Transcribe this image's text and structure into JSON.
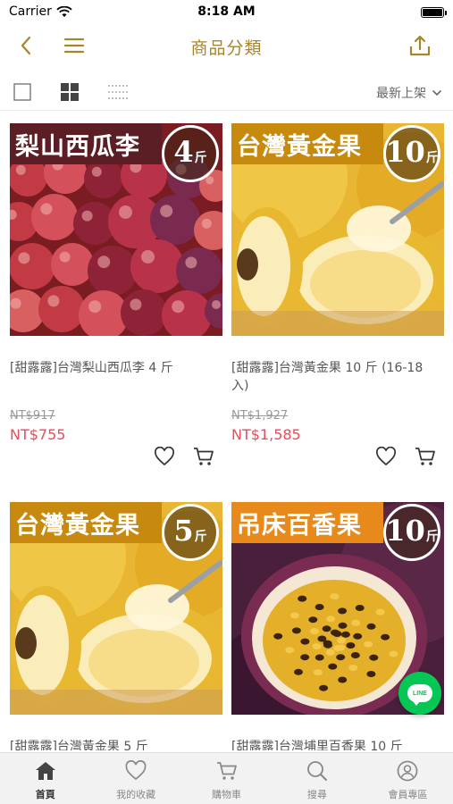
{
  "status_bar": {
    "carrier": "Carrier",
    "time": "8:18 AM",
    "battery_level": 1.0
  },
  "nav": {
    "title": "商品分類",
    "back_icon": "chevron-left-icon",
    "menu_icon": "menu-icon",
    "share_icon": "share-icon",
    "accent_color": "#a7852a"
  },
  "toolbar": {
    "sort_label": "最新上架",
    "views": [
      "single-view-icon",
      "grid-view-icon",
      "list-view-icon"
    ],
    "active_view": "grid-view-icon"
  },
  "products": [
    {
      "banner": "梨山西瓜李",
      "weight_num": "4",
      "weight_unit": "斤",
      "banner_color": "#5a1e24",
      "name": "[甜露露]台灣梨山西瓜李 4 斤",
      "old_price": "NT$917",
      "price": "NT$755"
    },
    {
      "banner": "台灣黃金果",
      "weight_num": "10",
      "weight_unit": "斤",
      "banner_color": "#c8890f",
      "name": "[甜露露]台灣黃金果 10 斤 (16-18 入)",
      "old_price": "NT$1,927",
      "price": "NT$1,585"
    },
    {
      "banner": "台灣黃金果",
      "weight_num": "5",
      "weight_unit": "斤",
      "banner_color": "#c8890f",
      "name": "[甜露露]台灣黃金果 5 斤",
      "old_price": "",
      "price": ""
    },
    {
      "banner": "吊床百香果",
      "weight_num": "10",
      "weight_unit": "斤",
      "banner_color": "#e8891c",
      "name": "[甜露露]台灣埔里百香果 10 斤",
      "old_price": "",
      "price": ""
    }
  ],
  "line_button": {
    "label": "LINE",
    "color": "#06c755"
  },
  "tabbar": {
    "active": 0,
    "items": [
      {
        "label": "首頁",
        "icon": "home-icon"
      },
      {
        "label": "我的收藏",
        "icon": "heart-icon"
      },
      {
        "label": "購物車",
        "icon": "cart-icon"
      },
      {
        "label": "搜尋",
        "icon": "search-icon"
      },
      {
        "label": "會員專區",
        "icon": "user-icon"
      }
    ]
  },
  "price_color": "#e94b5a"
}
